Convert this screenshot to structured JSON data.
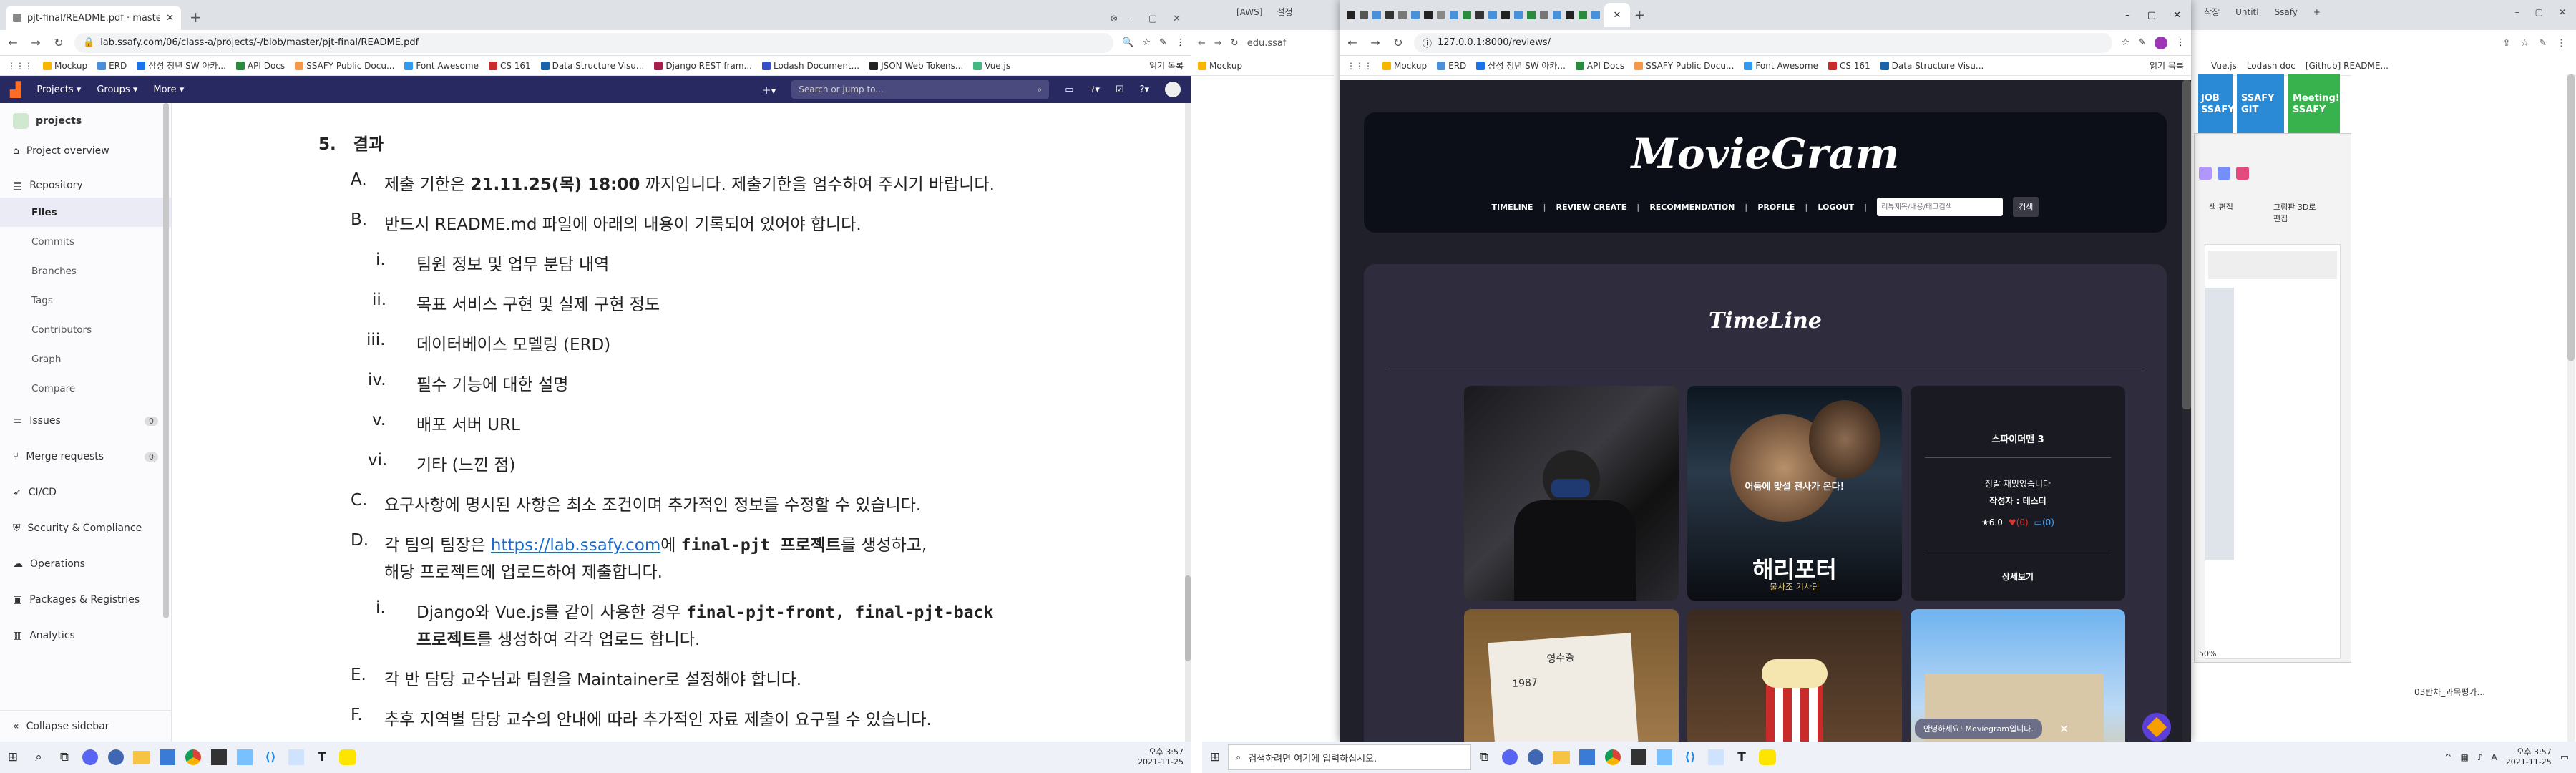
{
  "left_browser": {
    "tab_title": "pjt-final/README.pdf · master",
    "new_tab": "+",
    "url": "lab.ssafy.com/06/class-a/projects/-/blob/master/pjt-final/README.pdf",
    "bookmarks": [
      "Mockup",
      "ERD",
      "삼성 청년 SW 아카...",
      "API Docs",
      "SSAFY Public Docu...",
      "Font Awesome",
      "CS 161",
      "Data Structure Visu...",
      "Django REST fram...",
      "Lodash Document...",
      "JSON Web Tokens...",
      "Vue.js"
    ],
    "reading_list": "읽기 목록",
    "gitlab": {
      "menus": [
        "Projects",
        "Groups",
        "More"
      ],
      "search_placeholder": "Search or jump to...",
      "project_name": "projects",
      "sidebar": {
        "project_overview": "Project overview",
        "repository": "Repository",
        "repo_subitems": [
          "Files",
          "Commits",
          "Branches",
          "Tags",
          "Contributors",
          "Graph",
          "Compare"
        ],
        "issues": "Issues",
        "issues_count": "0",
        "merge_requests": "Merge requests",
        "mr_count": "0",
        "cicd": "CI/CD",
        "security": "Security & Compliance",
        "operations": "Operations",
        "packages": "Packages & Registries",
        "analytics": "Analytics",
        "collapse": "Collapse sidebar"
      }
    },
    "document": {
      "heading_num": "5.",
      "heading": "결과",
      "A_mark": "A.",
      "A_pre": "제출 기한은 ",
      "A_bold": "21.11.25(목) 18:00",
      "A_post": " 까지입니다. 제출기한을 엄수하여 주시기 바랍니다.",
      "B_mark": "B.",
      "B_text": "반드시 README.md 파일에 아래의 내용이 기록되어 있어야 합니다.",
      "B_items": [
        {
          "mark": "i.",
          "text": "팀원 정보 및 업무 분담 내역"
        },
        {
          "mark": "ii.",
          "text": "목표 서비스 구현 및 실제 구현 정도"
        },
        {
          "mark": "iii.",
          "text": "데이터베이스 모델링 (ERD)"
        },
        {
          "mark": "iv.",
          "text": "필수 기능에 대한 설명"
        },
        {
          "mark": "v.",
          "text": "배포 서버 URL"
        },
        {
          "mark": "vi.",
          "text": "기타 (느낀 점)"
        }
      ],
      "C_mark": "C.",
      "C_text": "요구사항에 명시된 사항은 최소 조건이며 추가적인 정보를 수정할 수 있습니다.",
      "D_mark": "D.",
      "D_pre": "각 팀의 팀장은 ",
      "D_link": "https://lab.ssafy.com",
      "D_mid": "에 ",
      "D_bold": "final-pjt 프로젝트",
      "D_post": "를 생성하고,",
      "D_line2": "해당 프로젝트에 업로드하여 제출합니다.",
      "D_i_mark": "i.",
      "D_i_pre": "Django와 Vue.js를 같이 사용한 경우 ",
      "D_i_bold": "final-pjt-front, final-pjt-back",
      "D_i_line2_bold": "프로젝트",
      "D_i_line2_post": "를 생성하여 각각 업로드 합니다.",
      "E_mark": "E.",
      "E_text": "각 반 담당 교수님과 팀원을 Maintainer로 설정해야 합니다.",
      "F_mark": "F.",
      "F_text": "추후 지역별 담당 교수의 안내에 따라 추가적인 자료 제출이 요구될 수 있습니다."
    }
  },
  "right_browser": {
    "back_tabs": [
      "[AWS]",
      "설정"
    ],
    "back_url": "edu.ssaf",
    "back_bookmarks": [
      "Mockup",
      "ERD",
      "삼성 청년 SW 아카...",
      "API Docs",
      "SSAFY Public Docu...",
      "Font Awesome",
      "CS 161",
      "Data Structure Visu..."
    ],
    "far_right_tabs": [
      "Vue.js",
      "Lodash doc",
      "[Github] README..."
    ],
    "far_right_tab_labels": [
      "착장",
      "Untitl",
      "Ssafy"
    ],
    "ssafy_tiles": [
      "JOB SSAFY",
      "SSAFY GIT",
      "Meeting! SSAFY"
    ],
    "paint_labels": [
      "색 편집",
      "그림판 3D로 편집"
    ],
    "zoom": "50%",
    "bottom_note": "03반차_과목평가...",
    "window_url": "127.0.0.1:8000/reviews/",
    "window_bookmarks": [
      "Mockup",
      "ERD",
      "삼성 청년 SW 아카...",
      "API Docs",
      "SSAFY Public Docu...",
      "Font Awesome",
      "CS 161",
      "Data Structure Visu..."
    ],
    "window_reading": "읽기 목록",
    "moviegram": {
      "brand": "MovieGram",
      "nav": [
        "TIMELINE",
        "REVIEW CREATE",
        "RECOMMENDATION",
        "PROFILE",
        "LOGOUT"
      ],
      "search_placeholder": "리뷰제목/내용/태그검색",
      "search_button": "검색",
      "section_title": "TimeLine",
      "featured_title": "스파이더맨 3",
      "featured_line": "정말 재밌었습니다",
      "featured_author": "작성자 : 테스터",
      "featured_rating": "6.0",
      "featured_likes": "(0)",
      "featured_comments": "(0)",
      "featured_button": "상세보기",
      "poster_title": "해리포터",
      "poster_subtitle": "불사조 기사단",
      "poster_tagline": "어둠에 맞설 전사가 온다!",
      "receipt_title": "영수증",
      "receipt_number": "1987",
      "toast": "안녕하세요! Moviegram입니다."
    }
  },
  "taskbar": {
    "left_time": "오후 3:57",
    "left_date": "2021-11-25",
    "search_text": "검색하려면 여기에 입력하십시오.",
    "right_time": "오후 3:57",
    "right_date": "2021-11-25"
  }
}
